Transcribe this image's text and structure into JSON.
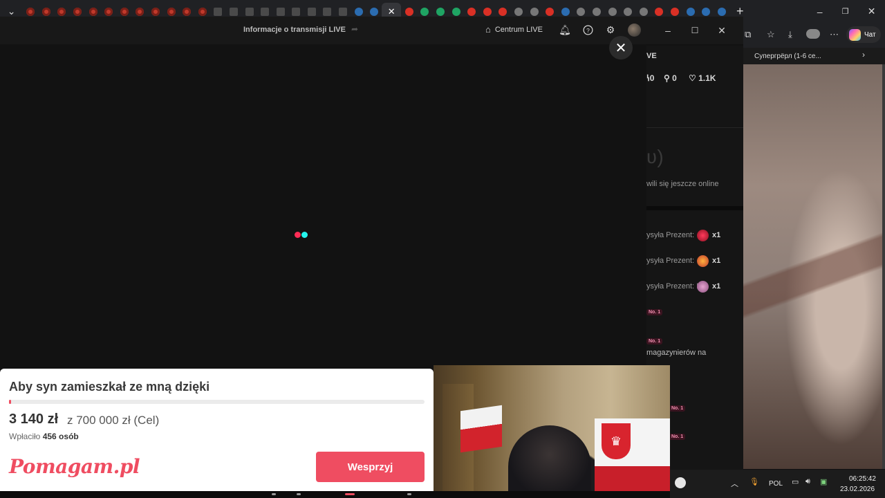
{
  "browser": {
    "side_tab_title": "Супергрёрл (1-6 се...",
    "chat_label": "Чат"
  },
  "tiktok": {
    "header_title": "Informacje o transmisji LIVE",
    "centrum_label": "Centrum LIVE",
    "panel": {
      "live_label": "VE",
      "stat_a": "0",
      "stat_b": "0",
      "likes": "1.1K",
      "online_text": "wili się jeszcze online",
      "gift_line_1": "ysyła Prezent:",
      "gift_line_2": "ysyła Prezent:",
      "gift_line_3": "ysyła Prezent: I",
      "gift_count": "x1",
      "badge": "No. 1",
      "message": "magazynierów na"
    }
  },
  "pomagam": {
    "title": "Aby syn zamieszkał ze mną dzięki",
    "amount": "3 140 zł",
    "goal": "z 700 000 zł (Cel)",
    "paid_prefix": "Wpłaciło",
    "paid_count": "456 osób",
    "logo": "Pomagam.pl",
    "button": "Wesprzyj",
    "progress_fraction": 0.0045
  },
  "taskbar": {
    "language": "POL",
    "time": "06:25:42",
    "date": "23.02.2026"
  },
  "colors": {
    "accent": "#ef4d61",
    "tiktok_red": "#fe2c55",
    "tiktok_cyan": "#25f4ee"
  }
}
